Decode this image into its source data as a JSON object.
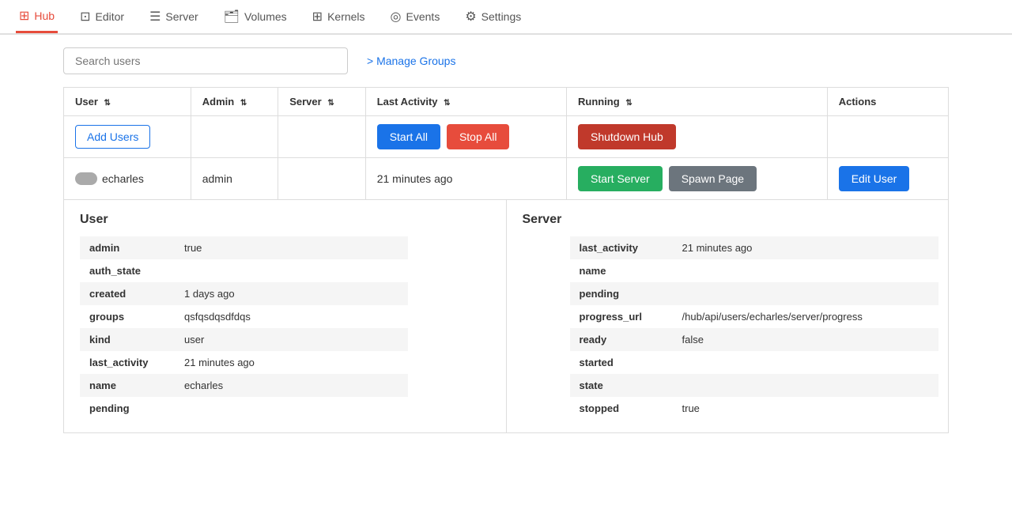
{
  "nav": {
    "items": [
      {
        "label": "Hub",
        "icon": "⊞",
        "active": true
      },
      {
        "label": "Editor",
        "icon": "⊡"
      },
      {
        "label": "Server",
        "icon": "☰"
      },
      {
        "label": "Volumes",
        "icon": "📁"
      },
      {
        "label": "Kernels",
        "icon": "⊞"
      },
      {
        "label": "Events",
        "icon": "◎"
      },
      {
        "label": "Settings",
        "icon": "⚙"
      }
    ]
  },
  "search": {
    "placeholder": "Search users"
  },
  "manage_groups": {
    "label": "> Manage Groups"
  },
  "table": {
    "headers": [
      {
        "label": "User",
        "sortable": true
      },
      {
        "label": "Admin",
        "sortable": true
      },
      {
        "label": "Server",
        "sortable": true
      },
      {
        "label": "Last Activity",
        "sortable": true
      },
      {
        "label": "Running",
        "sortable": true
      },
      {
        "label": "Actions",
        "sortable": false
      }
    ],
    "actions_row": {
      "add_users": "Add Users",
      "start_all": "Start All",
      "stop_all": "Stop All",
      "shutdown_hub": "Shutdown Hub"
    },
    "user_row": {
      "name": "echarles",
      "admin": "admin",
      "last_activity": "21 minutes ago",
      "start_server": "Start Server",
      "spawn_page": "Spawn Page",
      "edit_user": "Edit User"
    }
  },
  "user_panel": {
    "title": "User",
    "fields": [
      {
        "key": "admin",
        "value": "true"
      },
      {
        "key": "auth_state",
        "value": ""
      },
      {
        "key": "created",
        "value": "1 days ago"
      },
      {
        "key": "groups",
        "value": "qsfqsdqsdfdqs"
      },
      {
        "key": "kind",
        "value": "user"
      },
      {
        "key": "last_activity",
        "value": "21 minutes ago"
      },
      {
        "key": "name",
        "value": "echarles"
      },
      {
        "key": "pending",
        "value": ""
      }
    ]
  },
  "server_panel": {
    "title": "Server",
    "fields": [
      {
        "key": "last_activity",
        "value": "21 minutes ago"
      },
      {
        "key": "name",
        "value": ""
      },
      {
        "key": "pending",
        "value": ""
      },
      {
        "key": "progress_url",
        "value": "/hub/api/users/echarles/server/progress"
      },
      {
        "key": "ready",
        "value": "false"
      },
      {
        "key": "started",
        "value": ""
      },
      {
        "key": "state",
        "value": ""
      },
      {
        "key": "stopped",
        "value": "true"
      }
    ]
  },
  "colors": {
    "active_tab": "#e74c3c",
    "blue": "#1a73e8",
    "red": "#e74c3c",
    "dark_red": "#c0392b",
    "green": "#27ae60",
    "gray": "#6c757d"
  }
}
